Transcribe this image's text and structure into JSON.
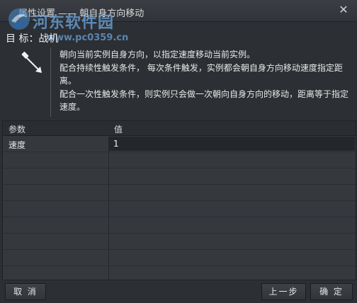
{
  "window": {
    "title": "属性设置 —— 朝自身方向移动",
    "close_glyph": "✕"
  },
  "watermark": {
    "name": "河东软件园",
    "url": "www.pc0359.cn"
  },
  "target": {
    "label": "目 标：战机"
  },
  "description": {
    "icon": "move-arrow-icon",
    "lines": [
      "朝向当前实例自身方向，以指定速度移动当前实例。",
      "配合持续性触发条件， 每次条件触发，实例都会朝自身方向移动速度指定距离。",
      "配合一次性触发条件，则实例只会做一次朝向自身方向的移动，距离等于指定速度。"
    ]
  },
  "table": {
    "headers": [
      "参数",
      "值"
    ],
    "rows": [
      {
        "param": "速度",
        "value": "1"
      }
    ]
  },
  "buttons": {
    "cancel": "取 消",
    "prev": "上一步",
    "ok": "确 定"
  },
  "colors": {
    "background": "#2c2f33",
    "panel": "#35383d",
    "header": "#2a2d31"
  }
}
